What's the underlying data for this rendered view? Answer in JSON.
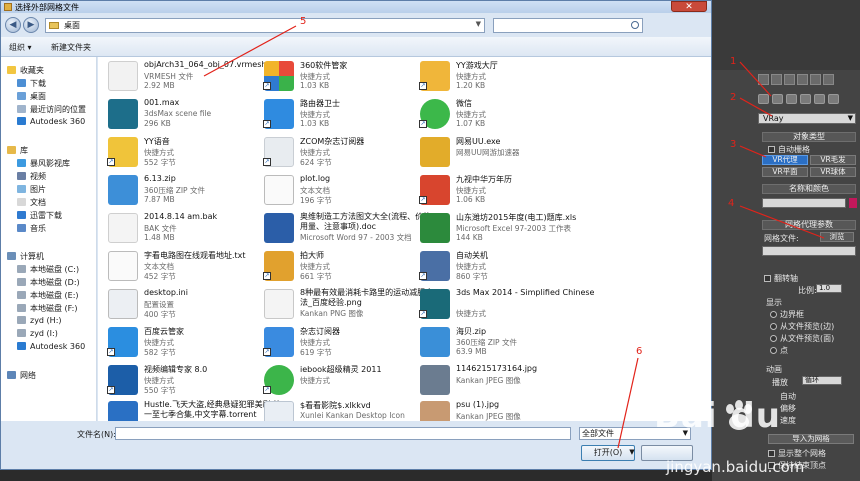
{
  "window": {
    "title": "选择外部网格文件"
  },
  "address": {
    "crumb": "桌面"
  },
  "toolbar": {
    "organize": "组织 ▾",
    "new_folder": "新建文件夹"
  },
  "nav": {
    "favorites": "收藏夹",
    "download": "下载",
    "desktop": "桌面",
    "recent": "最近访问的位置",
    "autodesk1": "Autodesk 360",
    "library": "库",
    "storm": "暴风影视库",
    "video": "视频",
    "pictures": "图片",
    "docs": "文档",
    "xunlei": "迅雷下载",
    "music": "音乐",
    "computer": "计算机",
    "disk_c": "本地磁盘 (C:)",
    "disk_d": "本地磁盘 (D:)",
    "disk_e": "本地磁盘 (E:)",
    "disk_f": "本地磁盘 (F:)",
    "zyd_h": "zyd (H:)",
    "zyd_i": "zyd (I:)",
    "autodesk2": "Autodesk 360",
    "network": "网络"
  },
  "files": [
    {
      "name": "objArch31_064_obj_07.vrmesh",
      "type": "VRMESH 文件",
      "size": "2.92 MB"
    },
    {
      "name": "360软件管家",
      "type": "快捷方式",
      "size": "1.03 KB"
    },
    {
      "name": "YY游戏大厅",
      "type": "快捷方式",
      "size": "1.20 KB"
    },
    {
      "name": "001.max",
      "type": "3dsMax scene file",
      "size": "296 KB"
    },
    {
      "name": "路由器卫士",
      "type": "快捷方式",
      "size": "1.03 KB"
    },
    {
      "name": "微信",
      "type": "快捷方式",
      "size": "1.07 KB"
    },
    {
      "name": "YY语音",
      "type": "快捷方式",
      "size": "552 字节"
    },
    {
      "name": "ZCOM杂志订阅器",
      "type": "快捷方式",
      "size": "624 字节"
    },
    {
      "name": "网易UU.exe",
      "type": "网易UU网游加速器",
      "size": ""
    },
    {
      "name": "6.13.zip",
      "type": "360压缩 ZIP 文件",
      "size": "7.87 MB"
    },
    {
      "name": "plot.log",
      "type": "文本文档",
      "size": "196 字节"
    },
    {
      "name": "九视中华万年历",
      "type": "快捷方式",
      "size": "1.06 KB"
    },
    {
      "name": "2014.8.14 am.bak",
      "type": "BAK 文件",
      "size": "1.48 MB"
    },
    {
      "name": "奥维制造工方法图文大全(流程、价格、用量、注意事项).doc",
      "type": "Microsoft Word 97 - 2003 文档",
      "size": ""
    },
    {
      "name": "山东潍坊2015年度(电工)题库.xls",
      "type": "Microsoft Excel 97-2003 工作表",
      "size": "144 KB"
    },
    {
      "name": "字看电路图在线观看地址.txt",
      "type": "文本文档",
      "size": "452 字节"
    },
    {
      "name": "拍大师",
      "type": "快捷方式",
      "size": "661 字节"
    },
    {
      "name": "自动关机",
      "type": "快捷方式",
      "size": "860 字节"
    },
    {
      "name": "desktop.ini",
      "type": "配置设置",
      "size": "400 字节"
    },
    {
      "name": "8种最有效最消耗卡路里的运动减肥方法_百度经验.png",
      "type": "Kankan PNG 图像",
      "size": ""
    },
    {
      "name": "3ds Max 2014 - Simplified Chinese",
      "type": "快捷方式",
      "size": ""
    },
    {
      "name": "百度云管家",
      "type": "快捷方式",
      "size": "582 字节"
    },
    {
      "name": "杂志订阅器",
      "type": "快捷方式",
      "size": "619 字节"
    },
    {
      "name": "海贝.zip",
      "type": "360压缩 ZIP 文件",
      "size": "63.9 MB"
    },
    {
      "name": "视频编辑专家 8.0",
      "type": "快捷方式",
      "size": "550 字节"
    },
    {
      "name": "iebook超级精灵 2011",
      "type": "快捷方式",
      "size": ""
    },
    {
      "name": "1146215173164.jpg",
      "type": "Kankan JPEG 图像",
      "size": ""
    },
    {
      "name": "Hustle.飞天大盗,经典悬疑犯罪美剧.第一至七季合集,中文字幕.torrent",
      "type": "",
      "size": ""
    },
    {
      "name": "$看看影院$.xlkkvd",
      "type": "Xunlei Kankan Desktop Icon",
      "size": ""
    },
    {
      "name": "psu (1).jpg",
      "type": "Kankan JPEG 图像",
      "size": ""
    }
  ],
  "bottom": {
    "filename_label": "文件名(N):",
    "filter": "全部文件",
    "open": "打开(O)"
  },
  "max": {
    "vray": "VRay",
    "obj_type": "对象类型",
    "auto_grid": "自动栅格",
    "vr_proxy": "VR代理",
    "vr_fur": "VR毛发",
    "vr_plane": "VR平面",
    "vr_sphere": "VR球体",
    "name_color": "名称和颜色",
    "mesh_params": "网格代理参数",
    "mesh_file": "网格文件:",
    "browse": "浏览",
    "flip_axis": "翻转轴",
    "scale_label": "比例:",
    "scale_value": "1.0",
    "display": "显示",
    "bbox": "边界框",
    "from_file_preview_edge": "从文件预览(边)",
    "from_file_preview_face": "从文件预览(面)",
    "point": "点",
    "anim": "动画",
    "playback": "播放",
    "loop": "循环",
    "auto": "自动",
    "offset": "偏移",
    "speed": "速度",
    "import_mesh": "导入为网格",
    "show_whole": "显示整个网格",
    "keep_vertex": "保持结束顶点"
  },
  "annotations": [
    "1",
    "2",
    "3",
    "4",
    "5",
    "6"
  ],
  "watermark": {
    "brand": "Bai du",
    "site": "jingyan.baidu.com"
  }
}
